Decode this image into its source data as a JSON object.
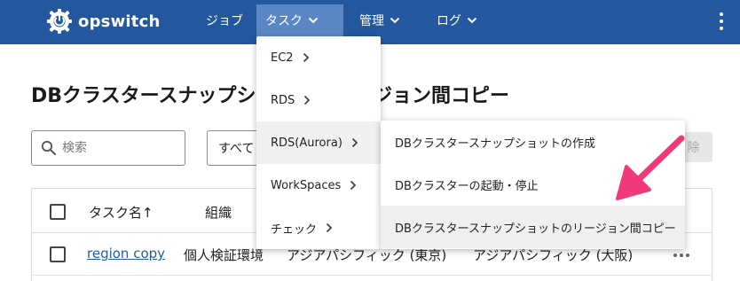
{
  "header": {
    "logo_text": "opswitch",
    "nav": [
      {
        "label": "ジョブ"
      },
      {
        "label": "タスク"
      },
      {
        "label": "管理"
      },
      {
        "label": "ログ"
      }
    ]
  },
  "page": {
    "title": "DBクラスタースナップショットのリージョン間コピー",
    "title_visible": "DBクラスタースナップショ",
    "search_placeholder": "検索",
    "filter_value": "すべて",
    "delete_label": "除"
  },
  "table": {
    "headers": [
      "タスク名",
      "組織"
    ],
    "sort_indicator": "↑",
    "rows": [
      {
        "task_name": "region copy",
        "org": "個人検証環境",
        "source_region": "アジアパシフィック (東京)",
        "dest_region": "アジアパシフィック (大阪)"
      }
    ]
  },
  "menu": {
    "items": [
      {
        "label": "EC2"
      },
      {
        "label": "RDS"
      },
      {
        "label": "RDS(Aurora)"
      },
      {
        "label": "WorkSpaces"
      },
      {
        "label": "チェック"
      }
    ]
  },
  "submenu": {
    "items": [
      {
        "label": "DBクラスタースナップショットの作成"
      },
      {
        "label": "DBクラスターの起動・停止"
      },
      {
        "label": "DBクラスタースナップショットのリージョン間コピー"
      }
    ]
  },
  "colors": {
    "header_bg": "#24589e",
    "nav_active": "#5b86c4",
    "link": "#1f5fa8",
    "annotation_arrow": "#f0387a"
  },
  "icons": {
    "logo": "power-gear-icon",
    "search": "search-icon",
    "chevron_down": "chevron-down-icon",
    "chevron_right": "chevron-right-icon",
    "kebab": "kebab-menu-icon"
  }
}
